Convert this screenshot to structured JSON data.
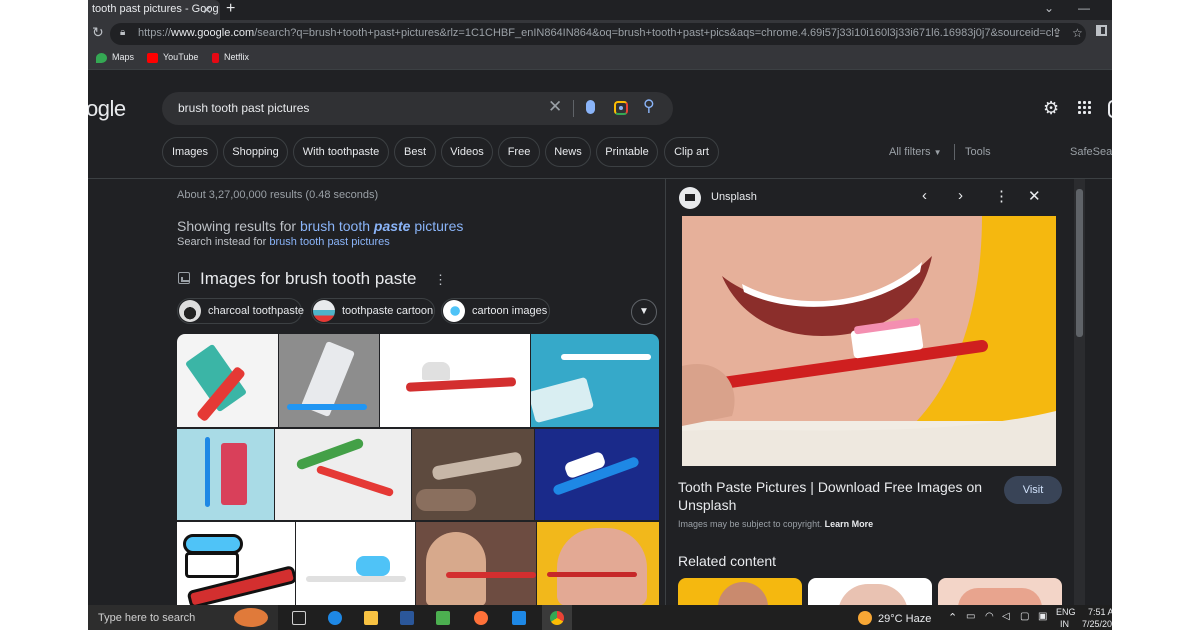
{
  "browser": {
    "tab_title": "tooth past pictures - Goog",
    "url_prefix": "https://",
    "url_domain": "www.google.com",
    "url_rest": "/search?q=brush+tooth+past+pictures&rlz=1C1CHBF_enIN864IN864&oq=brush+tooth+past+pics&aqs=chrome.4.69i57j33i10i160l3j33i671l6.16983j0j7&sourceid=chrom...",
    "bookmarks": [
      "Maps",
      "YouTube",
      "Netflix"
    ]
  },
  "google": {
    "logo_text": "ogle",
    "query": "brush tooth past pictures",
    "chips": [
      "Images",
      "Shopping",
      "With toothpaste",
      "Best",
      "Videos",
      "Free",
      "News",
      "Printable",
      "Clip art"
    ],
    "all_filters": "All filters",
    "tools": "Tools",
    "safesearch": "SafeSear"
  },
  "results": {
    "stats": "About 3,27,00,000 results (0.48 seconds)",
    "showing_prefix": "Showing results for ",
    "showing_link_a": "brush tooth ",
    "showing_link_b": "paste",
    "showing_link_c": " pictures",
    "instead_prefix": "Search instead for ",
    "instead_link": "brush tooth past pictures",
    "images_heading": "Images for brush tooth paste",
    "refinements": [
      "charcoal toothpaste",
      "toothpaste cartoon",
      "cartoon images"
    ]
  },
  "panel": {
    "source": "Unsplash",
    "title": "Tooth Paste Pictures | Download Free Images on Unsplash",
    "visit": "Visit",
    "copyright_prefix": "Images may be subject to copyright. ",
    "learn_more": "Learn More",
    "related": "Related content"
  },
  "taskbar": {
    "search_placeholder": "Type here to search",
    "weather": "29°C  Haze",
    "lang_1": "ENG",
    "lang_2": "IN",
    "time": "7:51 A",
    "date": "7/25/20"
  },
  "colors": {
    "background": "#202124",
    "link": "#8ab4f8",
    "text": "#e8eaed",
    "muted": "#9aa0a6"
  }
}
